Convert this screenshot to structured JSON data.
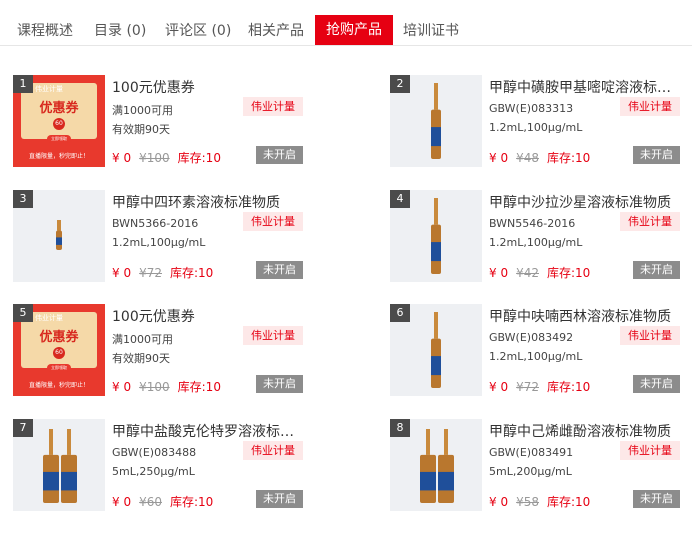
{
  "tabs": [
    {
      "label": "课程概述",
      "active": false
    },
    {
      "label": "目录 (0)",
      "active": false
    },
    {
      "label": "评论区 (0)",
      "active": false
    },
    {
      "label": "相关产品",
      "active": false
    },
    {
      "label": "抢购产品",
      "active": true
    },
    {
      "label": "培训证书",
      "active": false
    }
  ],
  "colors": {
    "accent": "#e60012",
    "tag_bg": "#fde8e8",
    "disabled_button": "#8c8c8c"
  },
  "coupon_art": {
    "header": "伟业计量",
    "title": "优惠券",
    "amount": "60",
    "button": "立即领取",
    "footer": "直播限量，秒完即止！"
  },
  "products": [
    {
      "num": "1",
      "title": "100元优惠券",
      "sub1": "满1000可用",
      "sub2": "有效期90天",
      "vendor": "伟业计量",
      "price": "¥ 0",
      "original_price": "¥100",
      "stock": "库存:10",
      "status": "未开启",
      "image": "coupon"
    },
    {
      "num": "2",
      "title": "甲醇中磺胺甲基嘧啶溶液标准物质",
      "sub1": "GBW(E)083313",
      "sub2": "1.2mL,100μg/mL",
      "vendor": "伟业计量",
      "price": "¥ 0",
      "original_price": "¥48",
      "stock": "库存:10",
      "status": "未开启",
      "image": "vial"
    },
    {
      "num": "3",
      "title": "甲醇中四环素溶液标准物质",
      "sub1": "BWN5366-2016",
      "sub2": "1.2mL,100μg/mL",
      "vendor": "伟业计量",
      "price": "¥ 0",
      "original_price": "¥72",
      "stock": "库存:10",
      "status": "未开启",
      "image": "vial-small"
    },
    {
      "num": "4",
      "title": "甲醇中沙拉沙星溶液标准物质",
      "sub1": "BWN5546-2016",
      "sub2": "1.2mL,100μg/mL",
      "vendor": "伟业计量",
      "price": "¥ 0",
      "original_price": "¥42",
      "stock": "库存:10",
      "status": "未开启",
      "image": "vial"
    },
    {
      "num": "5",
      "title": "100元优惠券",
      "sub1": "满1000可用",
      "sub2": "有效期90天",
      "vendor": "伟业计量",
      "price": "¥ 0",
      "original_price": "¥100",
      "stock": "库存:10",
      "status": "未开启",
      "image": "coupon"
    },
    {
      "num": "6",
      "title": "甲醇中呋喃西林溶液标准物质",
      "sub1": "GBW(E)083492",
      "sub2": "1.2mL,100μg/mL",
      "vendor": "伟业计量",
      "price": "¥ 0",
      "original_price": "¥72",
      "stock": "库存:10",
      "status": "未开启",
      "image": "vial"
    },
    {
      "num": "7",
      "title": "甲醇中盐酸克伦特罗溶液标准物质",
      "sub1": "GBW(E)083488",
      "sub2": "5mL,250μg/mL",
      "vendor": "伟业计量",
      "price": "¥ 0",
      "original_price": "¥60",
      "stock": "库存:10",
      "status": "未开启",
      "image": "vial-pair"
    },
    {
      "num": "8",
      "title": "甲醇中己烯雌酚溶液标准物质",
      "sub1": "GBW(E)083491",
      "sub2": "5mL,200μg/mL",
      "vendor": "伟业计量",
      "price": "¥ 0",
      "original_price": "¥58",
      "stock": "库存:10",
      "status": "未开启",
      "image": "vial-pair"
    }
  ]
}
